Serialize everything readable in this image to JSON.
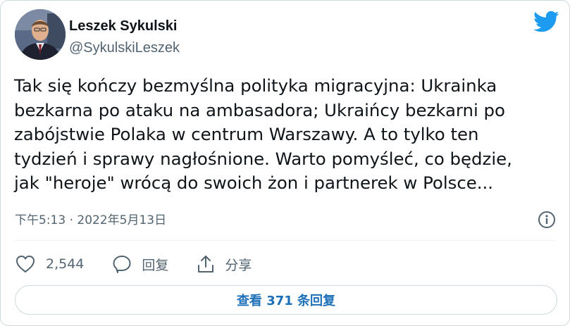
{
  "author": {
    "name": "Leszek Sykulski",
    "handle": "@SykulskiLeszek"
  },
  "tweet": {
    "lines": [
      "Tak się kończy bezmyślna polityka migracyjna: Ukrainka",
      "bezkarna po ataku na ambasadora; Ukraińcy bezkarni po",
      "zabójstwie Polaka w centrum Warszawy. A to tylko ten",
      "tydzień i sprawy nagłośnione. Warto pomyśleć, co będzie,",
      "jak \"heroje\" wrócą do swoich żon i partnerek w Polsce..."
    ],
    "timestamp": "下午5:13 · 2022年5月13日"
  },
  "actions": {
    "like_count": "2,544",
    "reply_label": "回复",
    "share_label": "分享"
  },
  "view_replies_label": "查看 371 条回复",
  "icons": {
    "brand": "twitter-bird-icon",
    "info": "info-icon",
    "like": "heart-icon",
    "reply": "reply-bubble-icon",
    "share": "share-icon"
  },
  "colors": {
    "brand": "#1d9bf0",
    "link": "#1d6fb8",
    "text": "#0f1419",
    "secondary": "#536471",
    "border": "#cfd9de"
  }
}
